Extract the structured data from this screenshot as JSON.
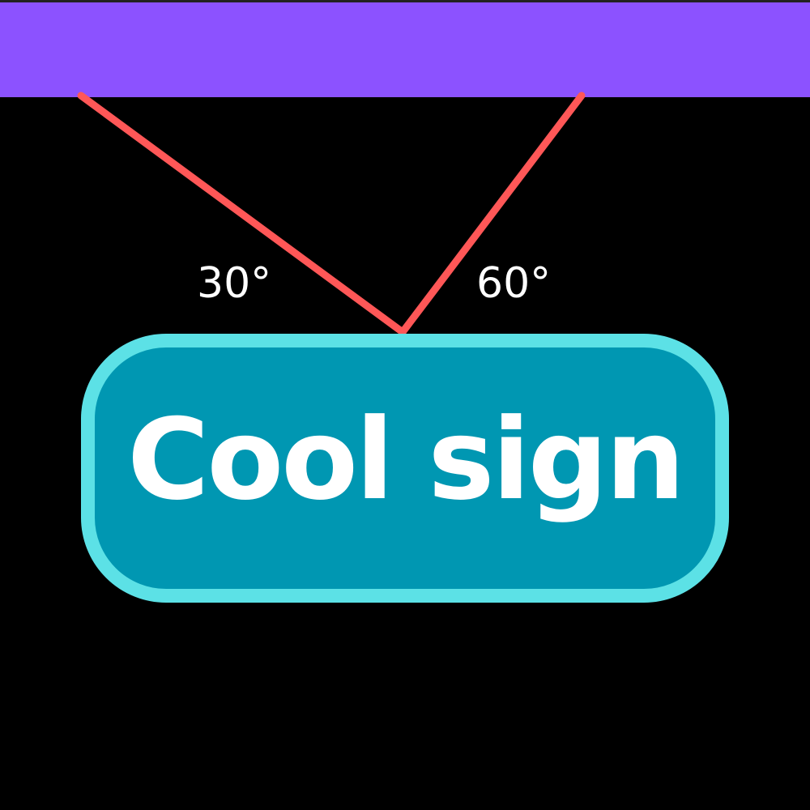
{
  "colors": {
    "background": "#000000",
    "ceiling": "#8c52ff",
    "rope": "#ff5757",
    "sign_fill": "#0097b2",
    "sign_border": "#5ce1e6",
    "text": "#ffffff"
  },
  "labels": {
    "left_angle": "30°",
    "right_angle": "60°"
  },
  "sign": {
    "text": "Cool sign"
  }
}
